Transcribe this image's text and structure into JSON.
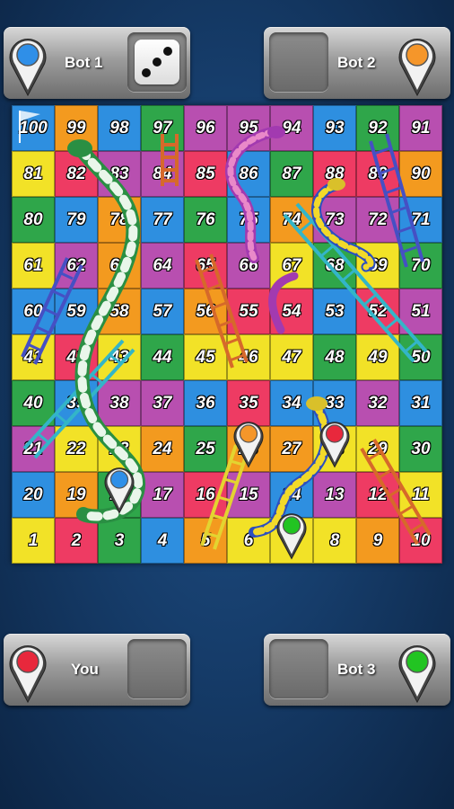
{
  "players": {
    "bot1": {
      "name": "Bot 1",
      "color": "#2f8fe8",
      "dice_value": 3
    },
    "bot2": {
      "name": "Bot 2",
      "color": "#f5962a"
    },
    "you": {
      "name": "You",
      "color": "#e8283c"
    },
    "bot3": {
      "name": "Bot 3",
      "color": "#22c422"
    }
  },
  "board": {
    "numbers": [
      [
        100,
        99,
        98,
        97,
        96,
        95,
        94,
        93,
        92,
        91
      ],
      [
        81,
        82,
        83,
        84,
        85,
        86,
        87,
        88,
        89,
        90
      ],
      [
        80,
        79,
        78,
        77,
        76,
        75,
        74,
        73,
        72,
        71
      ],
      [
        61,
        62,
        63,
        64,
        65,
        66,
        67,
        68,
        69,
        70
      ],
      [
        60,
        59,
        58,
        57,
        56,
        55,
        54,
        53,
        52,
        51
      ],
      [
        41,
        42,
        43,
        44,
        45,
        46,
        47,
        48,
        49,
        50
      ],
      [
        40,
        39,
        38,
        37,
        36,
        35,
        34,
        33,
        32,
        31
      ],
      [
        21,
        22,
        23,
        24,
        25,
        26,
        27,
        28,
        29,
        30
      ],
      [
        20,
        19,
        18,
        17,
        16,
        15,
        14,
        13,
        12,
        11
      ],
      [
        1,
        2,
        3,
        4,
        5,
        6,
        7,
        8,
        9,
        10
      ]
    ],
    "cell_colors": [
      [
        "#2e8fe0",
        "#f39a1f",
        "#2e8fe0",
        "#2fa64a",
        "#b84fb0",
        "#b84fb0",
        "#b84fb0",
        "#2e8fe0",
        "#2fa64a",
        "#b84fb0"
      ],
      [
        "#f2e227",
        "#ee3b63",
        "#b84fb0",
        "#b84fb0",
        "#ee3b63",
        "#2e8fe0",
        "#2fa64a",
        "#ee3b63",
        "#ee3b63",
        "#f39a1f"
      ],
      [
        "#2fa64a",
        "#2e8fe0",
        "#f39a1f",
        "#2e8fe0",
        "#2fa64a",
        "#2e8fe0",
        "#f39a1f",
        "#b84fb0",
        "#b84fb0",
        "#2e8fe0"
      ],
      [
        "#f2e227",
        "#b84fb0",
        "#f39a1f",
        "#b84fb0",
        "#ee3b63",
        "#b84fb0",
        "#f2e227",
        "#2fa64a",
        "#f2e227",
        "#2fa64a"
      ],
      [
        "#2e8fe0",
        "#2e8fe0",
        "#f39a1f",
        "#2e8fe0",
        "#f39a1f",
        "#ee3b63",
        "#ee3b63",
        "#2e8fe0",
        "#ee3b63",
        "#b84fb0"
      ],
      [
        "#f2e227",
        "#ee3b63",
        "#f2e227",
        "#2fa64a",
        "#f2e227",
        "#f2e227",
        "#f2e227",
        "#2fa64a",
        "#f2e227",
        "#2fa64a"
      ],
      [
        "#2fa64a",
        "#2e8fe0",
        "#b84fb0",
        "#b84fb0",
        "#2e8fe0",
        "#ee3b63",
        "#2e8fe0",
        "#2e8fe0",
        "#b84fb0",
        "#2e8fe0"
      ],
      [
        "#b84fb0",
        "#f2e227",
        "#f2e227",
        "#f39a1f",
        "#2fa64a",
        "#f39a1f",
        "#f39a1f",
        "#f2e227",
        "#f2e227",
        "#2fa64a"
      ],
      [
        "#2e8fe0",
        "#f39a1f",
        "#2fa64a",
        "#b84fb0",
        "#ee3b63",
        "#b84fb0",
        "#2e8fe0",
        "#b84fb0",
        "#ee3b63",
        "#f2e227"
      ],
      [
        "#f2e227",
        "#ee3b63",
        "#2fa64a",
        "#2e8fe0",
        "#f39a1f",
        "#f2e227",
        "#f2e227",
        "#f2e227",
        "#f39a1f",
        "#ee3b63"
      ]
    ]
  },
  "tokens": [
    {
      "player": "bot1",
      "cell": 18,
      "color": "#2f8fe8"
    },
    {
      "player": "bot2",
      "cell": 26,
      "color": "#f5962a"
    },
    {
      "player": "you",
      "cell": 28,
      "color": "#e8283c"
    },
    {
      "player": "bot3",
      "cell": 7,
      "color": "#22c422"
    }
  ]
}
